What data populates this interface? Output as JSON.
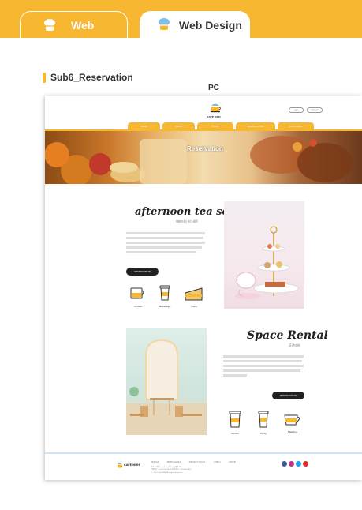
{
  "tabs": [
    {
      "label": "Web"
    },
    {
      "label": "Web Design"
    }
  ],
  "section": {
    "title": "Sub6_Reservation"
  },
  "device_label": "PC",
  "header": {
    "logo_text": "CAFE NHH",
    "buttons": [
      "▢▢",
      "▢▢▢▢"
    ],
    "nav": [
      "MENU",
      "MENU",
      "EVENT",
      "RESERVATION",
      "CUSTOMER"
    ]
  },
  "hero": {
    "title": "Reservation"
  },
  "tea_set": {
    "title": "afternoon tea set",
    "subtitle": "애프터눈 티 세트",
    "button": "RESERVATION",
    "icons": [
      {
        "label": "Coffee"
      },
      {
        "label": "Beverage"
      },
      {
        "label": "Cake"
      }
    ]
  },
  "rental": {
    "title": "Space Rental",
    "subtitle": "공간대여",
    "button": "RESERVATION",
    "icons": [
      {
        "label": "Studio"
      },
      {
        "label": "Party"
      },
      {
        "label": "Meeting"
      }
    ]
  },
  "footer": {
    "logo_text": "CAFE NHH",
    "links": [
      "이용약관",
      "개인정보처리방침",
      "이메일무단수집거부",
      "고객센터",
      "사이트맵"
    ],
    "info": [
      "주소 : 서울시 ○○구 ○○로 12 ○○빌딩 1층",
      "대표번호 : 010-1234-5678  사업자번호 : 123-45-67890",
      "© 2022 Cafe NHH. All Rights Reserved."
    ]
  },
  "colors": {
    "accent": "#f7b731",
    "dark": "#222222"
  }
}
